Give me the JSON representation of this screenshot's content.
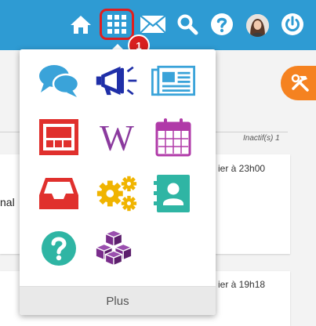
{
  "notifications": {
    "count": "1"
  },
  "background": {
    "inactifs": "Inactif(s) 1",
    "card1_time": "ier à 23h00",
    "card1_text": "nal",
    "card2_time": "ier à 19h18"
  },
  "apps_menu": {
    "more_label": "Plus",
    "apps": [
      {
        "icon": "speech-bubbles-icon",
        "color": "#3aa3d9"
      },
      {
        "icon": "megaphone-icon",
        "color": "#1f2fa8"
      },
      {
        "icon": "newspaper-icon",
        "color": "#3aa3d9"
      },
      {
        "icon": "presentation-board-icon",
        "color": "#e0302d"
      },
      {
        "icon": "wikipedia-icon",
        "color": "#8b3a9e"
      },
      {
        "icon": "calendar-icon",
        "color": "#b03aa8"
      },
      {
        "icon": "inbox-tray-icon",
        "color": "#e0302d"
      },
      {
        "icon": "gears-icon",
        "color": "#f0b400"
      },
      {
        "icon": "contact-book-icon",
        "color": "#2fb5a4"
      },
      {
        "icon": "help-circle-icon",
        "color": "#2fb5a4"
      },
      {
        "icon": "cubes-icon",
        "color": "#7a2d8c"
      }
    ]
  },
  "colors": {
    "topbar": "#2e9bd3",
    "highlight": "#e01e1e",
    "tools": "#f58220"
  }
}
